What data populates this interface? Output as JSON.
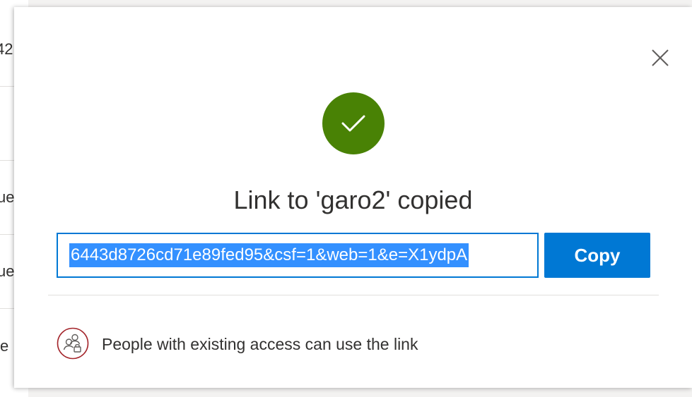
{
  "background_list": {
    "rows": [
      "42",
      "",
      "ue",
      "ue",
      "e"
    ]
  },
  "dialog": {
    "title": "Link to 'garo2' copied",
    "link_value": "6443d8726cd71e89fed95&csf=1&web=1&e=X1ydpA",
    "copy_label": "Copy",
    "access_message": "People with existing access can use the link",
    "icons": {
      "close": "close-icon",
      "success": "checkmark-icon",
      "access": "people-access-icon"
    }
  },
  "colors": {
    "success_green": "#498205",
    "primary_blue": "#0078d4",
    "selection_blue": "#3390ff",
    "access_icon_border": "#a4262c"
  }
}
